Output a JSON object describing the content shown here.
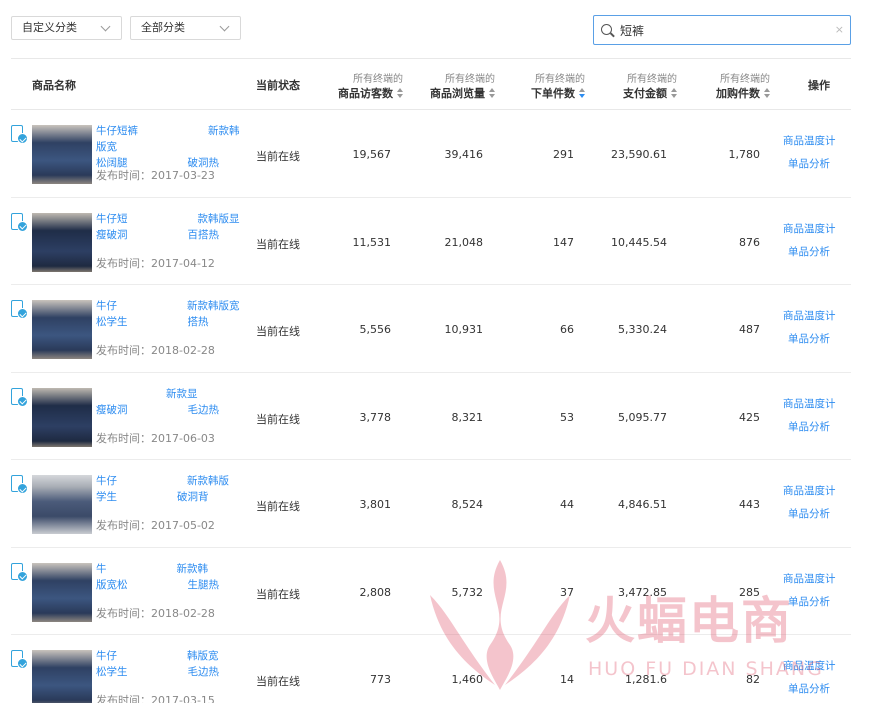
{
  "filters": {
    "custom_category": "自定义分类",
    "all_category": "全部分类"
  },
  "search": {
    "value": "短裤"
  },
  "headers": {
    "product_name": "商品名称",
    "status": "当前状态",
    "prefix": "所有终端的",
    "visitors": "商品访客数",
    "views": "商品浏览量",
    "orders": "下单件数",
    "payment": "支付金额",
    "cart": "加购件数",
    "ops": "操作"
  },
  "colors": {
    "link": "#2d8cf0",
    "accent": "#33a3dc",
    "watermark": "#e05a6f"
  },
  "rows": [
    {
      "title_l1": "牛仔短裤",
      "title_l1b": "新款韩版宽",
      "title_l2": "松阔腿",
      "title_l2b": "破洞热",
      "published": "发布时间：2017-03-23",
      "status": "当前在线",
      "visitors": "19,567",
      "views": "39,416",
      "orders": "291",
      "payment": "23,590.61",
      "cart": "1,780",
      "op1": "商品温度计",
      "op2": "单品分析",
      "thumb": "jeans"
    },
    {
      "title_l1": "牛仔短",
      "title_l1b": "款韩版显",
      "title_l2": "瘦破洞",
      "title_l2b": "百搭热",
      "published": "发布时间：2017-04-12",
      "status": "当前在线",
      "visitors": "11,531",
      "views": "21,048",
      "orders": "147",
      "payment": "10,445.54",
      "cart": "876",
      "op1": "商品温度计",
      "op2": "单品分析",
      "thumb": "dark"
    },
    {
      "title_l1": "牛仔",
      "title_l1b": "新款韩版宽",
      "title_l2": "松学生",
      "title_l2b": "搭热",
      "published": "发布时间：2018-02-28",
      "status": "当前在线",
      "visitors": "5,556",
      "views": "10,931",
      "orders": "66",
      "payment": "5,330.24",
      "cart": "487",
      "op1": "商品温度计",
      "op2": "单品分析",
      "thumb": "jeans"
    },
    {
      "title_l1": "",
      "title_l1b": "新款显",
      "title_l2": "瘦破洞",
      "title_l2b": "毛边热",
      "published": "发布时间：2017-06-03",
      "status": "当前在线",
      "visitors": "3,778",
      "views": "8,321",
      "orders": "53",
      "payment": "5,095.77",
      "cart": "425",
      "op1": "商品温度计",
      "op2": "单品分析",
      "thumb": "dark"
    },
    {
      "title_l1": "牛仔",
      "title_l1b": "新款韩版",
      "title_l2": "学生",
      "title_l2b": "破洞背",
      "published": "发布时间：2017-05-02",
      "status": "当前在线",
      "visitors": "3,801",
      "views": "8,524",
      "orders": "44",
      "payment": "4,846.51",
      "cart": "443",
      "op1": "商品温度计",
      "op2": "单品分析",
      "thumb": "person"
    },
    {
      "title_l1": "牛",
      "title_l1b": "新款韩",
      "title_l2": "版宽松",
      "title_l2b": "生腿热",
      "published": "发布时间：2018-02-28",
      "status": "当前在线",
      "visitors": "2,808",
      "views": "5,732",
      "orders": "37",
      "payment": "3,472.85",
      "cart": "285",
      "op1": "商品温度计",
      "op2": "单品分析",
      "thumb": "jeans"
    },
    {
      "title_l1": "牛仔",
      "title_l1b": "韩版宽",
      "title_l2": "松学生",
      "title_l2b": "毛边热",
      "published": "发布时间：2017-03-15",
      "status": "当前在线",
      "visitors": "773",
      "views": "1,460",
      "orders": "14",
      "payment": "1,281.6",
      "cart": "82",
      "op1": "商品温度计",
      "op2": "单品分析",
      "thumb": "jeans"
    }
  ],
  "watermark": {
    "text": "火蝠电商",
    "sub": "HUO FU DIAN SHANG"
  }
}
